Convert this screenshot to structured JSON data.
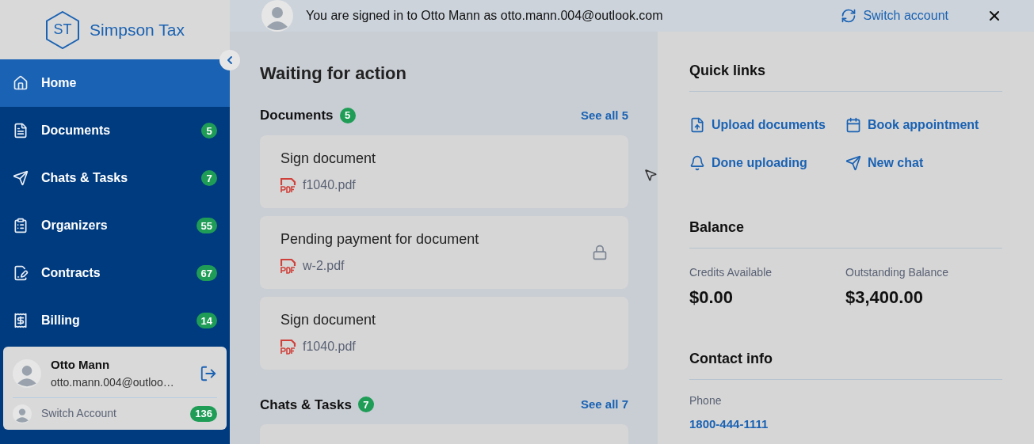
{
  "brand": {
    "initials": "ST",
    "name": "Simpson Tax"
  },
  "nav": [
    {
      "kind": "home",
      "label": "Home",
      "selected": true
    },
    {
      "kind": "documents",
      "label": "Documents",
      "badge": "5",
      "selected": false
    },
    {
      "kind": "chats",
      "label": "Chats & Tasks",
      "badge": "7",
      "selected": false
    },
    {
      "kind": "organizers",
      "label": "Organizers",
      "badge": "55",
      "selected": false
    },
    {
      "kind": "contracts",
      "label": "Contracts",
      "badge": "67",
      "selected": false
    },
    {
      "kind": "billing",
      "label": "Billing",
      "badge": "14",
      "selected": false
    }
  ],
  "account": {
    "name": "Otto Mann",
    "email": "otto.mann.004@outloo…",
    "switch_label": "Switch Account",
    "switch_badge": "136"
  },
  "banner": {
    "text": "You are signed in to Otto Mann as otto.mann.004@outlook.com",
    "switch": "Switch account"
  },
  "main": {
    "title": "Waiting for action",
    "documents": {
      "title": "Documents",
      "count": "5",
      "see_all": "See all 5",
      "items": [
        {
          "title": "Sign document",
          "file": "f1040.pdf",
          "locked": false
        },
        {
          "title": "Pending payment for document",
          "file": "w-2.pdf",
          "locked": true
        },
        {
          "title": "Sign document",
          "file": "f1040.pdf",
          "locked": false
        }
      ]
    },
    "chats": {
      "title": "Chats & Tasks",
      "count": "7",
      "see_all": "See all 7"
    }
  },
  "quick_links": {
    "title": "Quick links",
    "links": [
      {
        "kind": "upload",
        "label": "Upload documents"
      },
      {
        "kind": "calendar",
        "label": "Book appointment"
      },
      {
        "kind": "bell",
        "label": "Done uploading"
      },
      {
        "kind": "send",
        "label": "New chat"
      }
    ]
  },
  "balance": {
    "title": "Balance",
    "items": [
      {
        "label": "Credits Available",
        "value": "$0.00"
      },
      {
        "label": "Outstanding Balance",
        "value": "$3,400.00"
      }
    ]
  },
  "contact": {
    "title": "Contact info",
    "phone_label": "Phone",
    "phone": "1800-444-1111"
  }
}
